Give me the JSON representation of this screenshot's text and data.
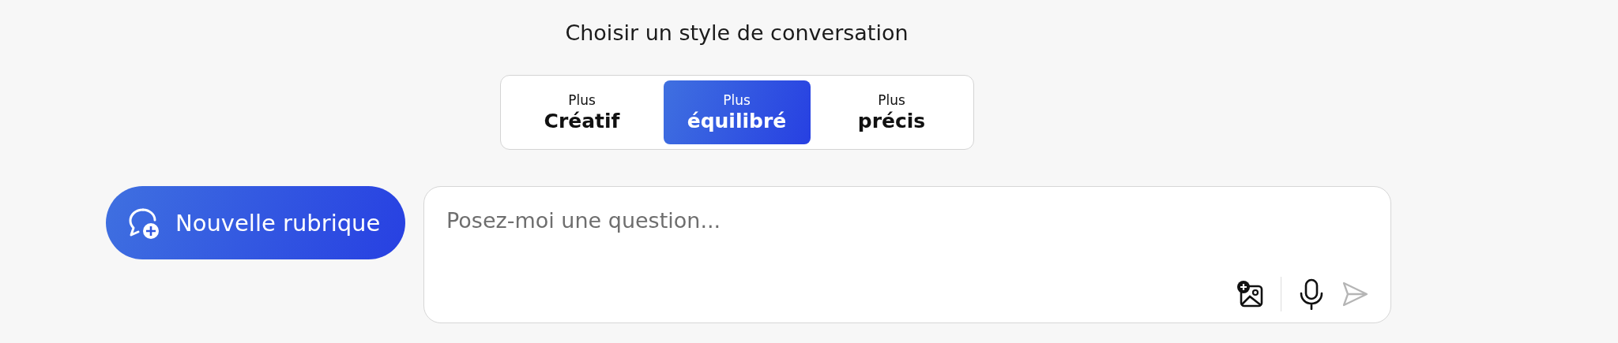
{
  "heading": "Choisir un style de conversation",
  "styles": [
    {
      "prefix": "Plus",
      "label": "Créatif",
      "selected": false
    },
    {
      "prefix": "Plus",
      "label": "équilibré",
      "selected": true
    },
    {
      "prefix": "Plus",
      "label": "précis",
      "selected": false
    }
  ],
  "new_topic_button": "Nouvelle rubrique",
  "input": {
    "placeholder": "Posez-moi une question..."
  }
}
